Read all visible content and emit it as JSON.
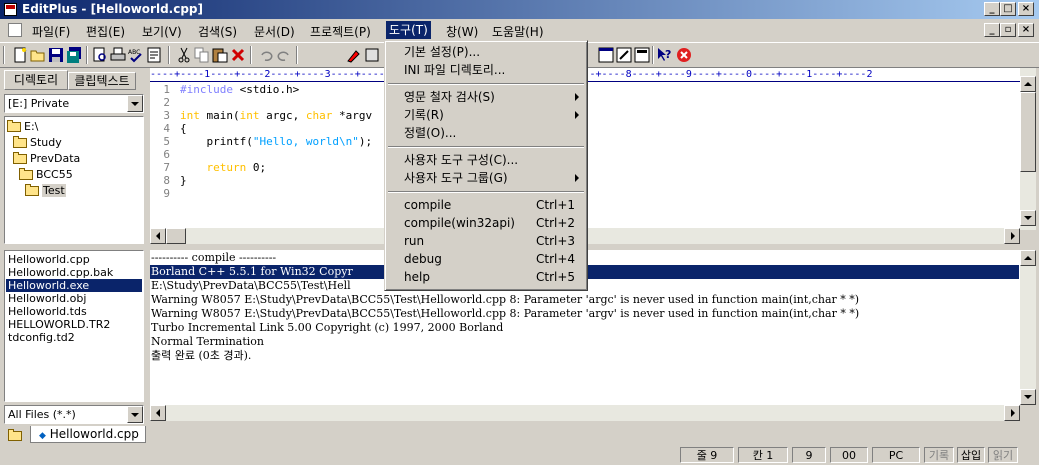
{
  "window": {
    "title": "EditPlus - [Helloworld.cpp]"
  },
  "menubar": {
    "items": [
      "파일(F)",
      "편집(E)",
      "보기(V)",
      "검색(S)",
      "문서(D)",
      "프로젝트(P)",
      "도구(T)",
      "창(W)",
      "도움말(H)"
    ]
  },
  "tools_menu": {
    "items": [
      {
        "label": "기본 설정(P)...",
        "accel": ""
      },
      {
        "label": "INI 파일 디렉토리...",
        "accel": ""
      },
      {
        "label": "영문 철자 검사(S)",
        "accel": ""
      },
      {
        "label": "기록(R)",
        "accel": ""
      },
      {
        "label": "정렬(O)...",
        "accel": ""
      },
      {
        "label": "사용자 도구 구성(C)...",
        "accel": ""
      },
      {
        "label": "사용자 도구 그룹(G)",
        "accel": ""
      },
      {
        "label": "compile",
        "accel": "Ctrl+1"
      },
      {
        "label": "compile(win32api)",
        "accel": "Ctrl+2"
      },
      {
        "label": "run",
        "accel": "Ctrl+3"
      },
      {
        "label": "debug",
        "accel": "Ctrl+4"
      },
      {
        "label": "help",
        "accel": "Ctrl+5"
      }
    ]
  },
  "left_panel": {
    "tabs": [
      "디렉토리",
      "클립텍스트"
    ],
    "drive": "[E:] Private",
    "tree": [
      "E:\\",
      "Study",
      "PrevData",
      "BCC55",
      "Test"
    ],
    "files": [
      "Helloworld.cpp",
      "Helloworld.cpp.bak",
      "Helloworld.exe",
      "Helloworld.obj",
      "Helloworld.tds",
      "HELLOWORLD.TR2",
      "tdconfig.td2"
    ],
    "selected_file": "Helloworld.exe",
    "filter": "All Files (*.*)"
  },
  "editor": {
    "ruler": "----+----1----+----2----+----3----+----4----+----5----+----6----+----7----+----8----+----9----+----0----+----1----+----2",
    "lines": [
      {
        "num": "1",
        "pre": "#include",
        "rest": " <stdio.h>"
      },
      {
        "num": "2",
        "text": ""
      },
      {
        "num": "3",
        "kw1": "int",
        "t1": " main(",
        "kw2": "int",
        "t2": " argc, ",
        "kw3": "char",
        "t3": " *argv"
      },
      {
        "num": "4",
        "text": "{"
      },
      {
        "num": "5",
        "t1": "    printf(",
        "str": "\"Hello, world\\n\"",
        "t2": ");"
      },
      {
        "num": "6",
        "text": ""
      },
      {
        "num": "7",
        "kw1": "    return",
        "t1": " 0;"
      },
      {
        "num": "8",
        "text": "}"
      },
      {
        "num": "9",
        "text": ""
      }
    ]
  },
  "output": {
    "lines": [
      "---------- compile ----------",
      "Borland C++ 5.5.1 for Win32 Copyr",
      "E:\\Study\\PrevData\\BCC55\\Test\\Hell",
      "Warning W8057 E:\\Study\\PrevData\\BCC55\\Test\\Helloworld.cpp 8: Parameter 'argc' is never used in function main(int,char * *)",
      "Warning W8057 E:\\Study\\PrevData\\BCC55\\Test\\Helloworld.cpp 8: Parameter 'argv' is never used in function main(int,char * *)",
      "Turbo Incremental Link 5.00 Copyright (c) 1997, 2000 Borland",
      "Normal Termination",
      "출력 완료 (0초 경과)."
    ],
    "highlighted_index": 1
  },
  "doc_tab": {
    "label": "Helloworld.cpp"
  },
  "statusbar": {
    "line_label": "줄 9",
    "col_label": "칸 1",
    "col_num": "9",
    "code": "00",
    "mode": "PC",
    "rec": "기록",
    "ins": "삽입",
    "read": "읽기"
  }
}
